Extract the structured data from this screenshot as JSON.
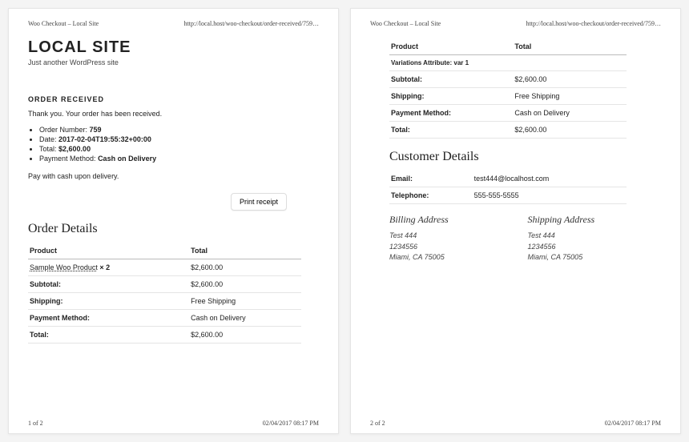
{
  "header": {
    "browser_title": "Woo Checkout – Local Site",
    "url": "http://local.host/woo-checkout/order-received/759…"
  },
  "site": {
    "title": "LOCAL SITE",
    "tagline": "Just another WordPress site"
  },
  "order": {
    "received_heading": "ORDER RECEIVED",
    "thankyou": "Thank you. Your order has been received.",
    "number_label": "Order Number:",
    "number": "759",
    "date_label": "Date:",
    "date": "2017-02-04T19:55:32+00:00",
    "total_label": "Total:",
    "total": "$2,600.00",
    "payment_label": "Payment Method:",
    "payment": "Cash on Delivery",
    "pay_note": "Pay with cash upon delivery.",
    "print_button": "Print receipt"
  },
  "details": {
    "heading": "Order Details",
    "col_product": "Product",
    "col_total": "Total",
    "product_name": "Sample Woo Product",
    "product_qty": " × 2",
    "product_total": "$2,600.00",
    "rows": {
      "subtotal_k": "Subtotal:",
      "subtotal_v": "$2,600.00",
      "shipping_k": "Shipping:",
      "shipping_v": "Free Shipping",
      "pay_k": "Payment Method:",
      "pay_v": "Cash on Delivery",
      "total_k": "Total:",
      "total_v": "$2,600.00"
    }
  },
  "p2_top": {
    "col_product": "Product",
    "col_total": "Total",
    "variation_line": "Variations Attribute: var 1",
    "subtotal_k": "Subtotal:",
    "subtotal_v": "$2,600.00",
    "shipping_k": "Shipping:",
    "shipping_v": "Free Shipping",
    "pay_k": "Payment Method:",
    "pay_v": "Cash on Delivery",
    "total_k": "Total:",
    "total_v": "$2,600.00"
  },
  "customer": {
    "heading": "Customer Details",
    "email_k": "Email:",
    "email_v": "test444@localhost.com",
    "phone_k": "Telephone:",
    "phone_v": "555-555-5555",
    "billing_h": "Billing Address",
    "shipping_h": "Shipping Address",
    "billing": {
      "l1": "Test 444",
      "l2": "1234556",
      "l3": "Miami, CA 75005"
    },
    "shipping": {
      "l1": "Test 444",
      "l2": "1234556",
      "l3": "Miami, CA 75005"
    }
  },
  "footer": {
    "p1_num": "1 of 2",
    "p2_num": "2 of 2",
    "printed": "02/04/2017 08:17 PM"
  }
}
